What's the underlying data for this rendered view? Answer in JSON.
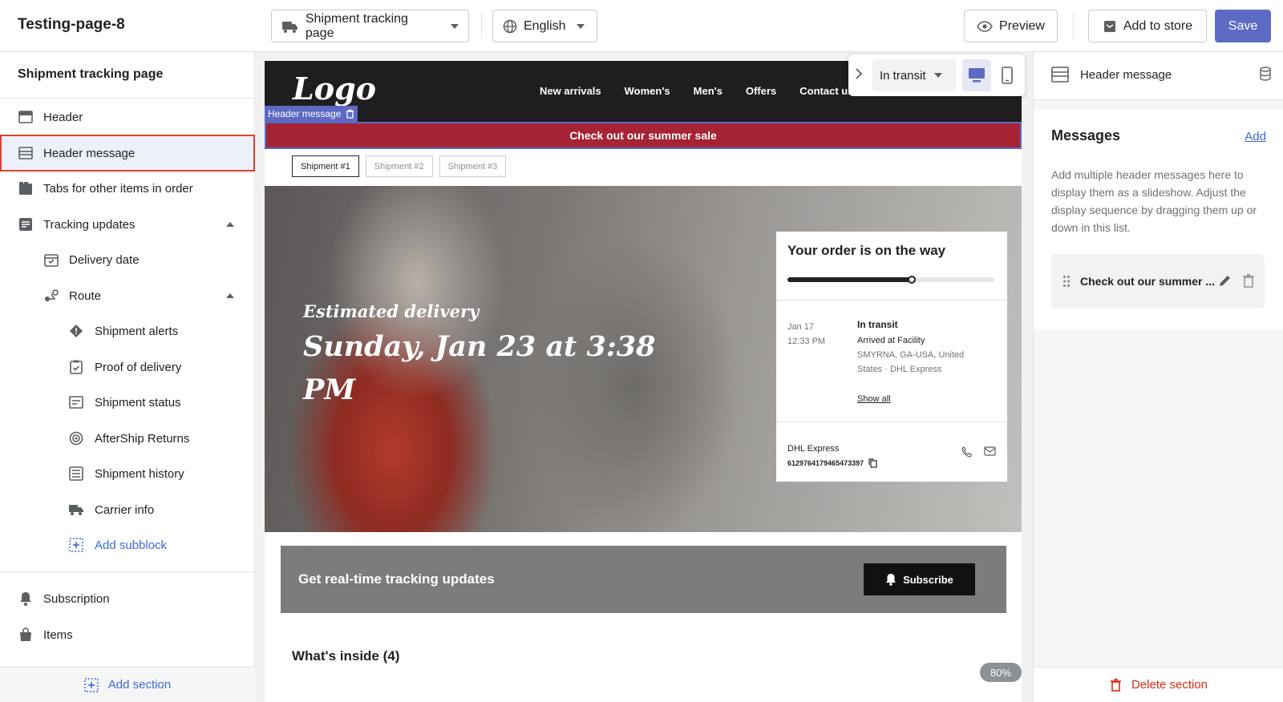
{
  "topbar": {
    "page_name": "Testing-page-8",
    "page_select": "Shipment tracking page",
    "language_select": "English",
    "preview_label": "Preview",
    "add_to_store_label": "Add to store",
    "save_label": "Save",
    "accent_color": "#5c6ac4"
  },
  "sidebar": {
    "title": "Shipment tracking page",
    "items": [
      {
        "label": "Header",
        "icon": "header-icon"
      },
      {
        "label": "Header message",
        "icon": "header-message-icon",
        "selected": true
      },
      {
        "label": "Tabs for other items in order",
        "icon": "tabs-icon"
      },
      {
        "label": "Tracking updates",
        "icon": "list-icon",
        "expanded": true
      },
      {
        "label": "Delivery date",
        "icon": "calendar-icon"
      },
      {
        "label": "Route",
        "icon": "route-icon",
        "expanded": true
      },
      {
        "label": "Shipment alerts",
        "icon": "alert-icon"
      },
      {
        "label": "Proof of delivery",
        "icon": "clipboard-icon"
      },
      {
        "label": "Shipment status",
        "icon": "status-icon"
      },
      {
        "label": "AfterShip Returns",
        "icon": "returns-icon"
      },
      {
        "label": "Shipment history",
        "icon": "history-icon"
      },
      {
        "label": "Carrier info",
        "icon": "truck-icon"
      },
      {
        "label": "Add subblock",
        "icon": "add-block-icon"
      },
      {
        "label": "Subscription",
        "icon": "bell-icon"
      },
      {
        "label": "Items",
        "icon": "bag-icon"
      }
    ],
    "add_section": "Add section"
  },
  "preview": {
    "logo": "Logo",
    "nav": [
      "New arrivals",
      "Women's",
      "Men's",
      "Offers",
      "Contact us"
    ],
    "header_message_tag": "Header message",
    "announcement": "Check out our summer sale",
    "announcement_color": "#a62333",
    "shipment_tabs": [
      "Shipment #1",
      "Shipment #2",
      "Shipment #3"
    ],
    "hero_subtitle": "Estimated delivery",
    "hero_date": "Sunday, Jan 23 at 3:38 PM",
    "order_card": {
      "title": "Your order is on the way",
      "progress": 0.6,
      "date": "Jan 17",
      "time": "12:33 PM",
      "status": "In transit",
      "detail_1": "Arrived at Facility",
      "detail_2": "SMYRNA, GA-USA, United States · DHL Express",
      "show_all": "Show all",
      "carrier": "DHL Express",
      "tracking_number": "6129764179465473397"
    },
    "subscribe_text": "Get real-time tracking updates",
    "subscribe_button": "Subscribe",
    "whats_inside": "What's inside (4)",
    "status_select": "In transit",
    "zoom": "80%"
  },
  "right_panel": {
    "header_title": "Header message",
    "messages_title": "Messages",
    "add_link": "Add",
    "description": "Add multiple header messages here to display them as a slideshow. Adjust the display sequence by dragging them up or down in this list.",
    "message_item": "Check out our summer ...",
    "delete_section": "Delete section",
    "danger_color": "#d72c0d"
  }
}
